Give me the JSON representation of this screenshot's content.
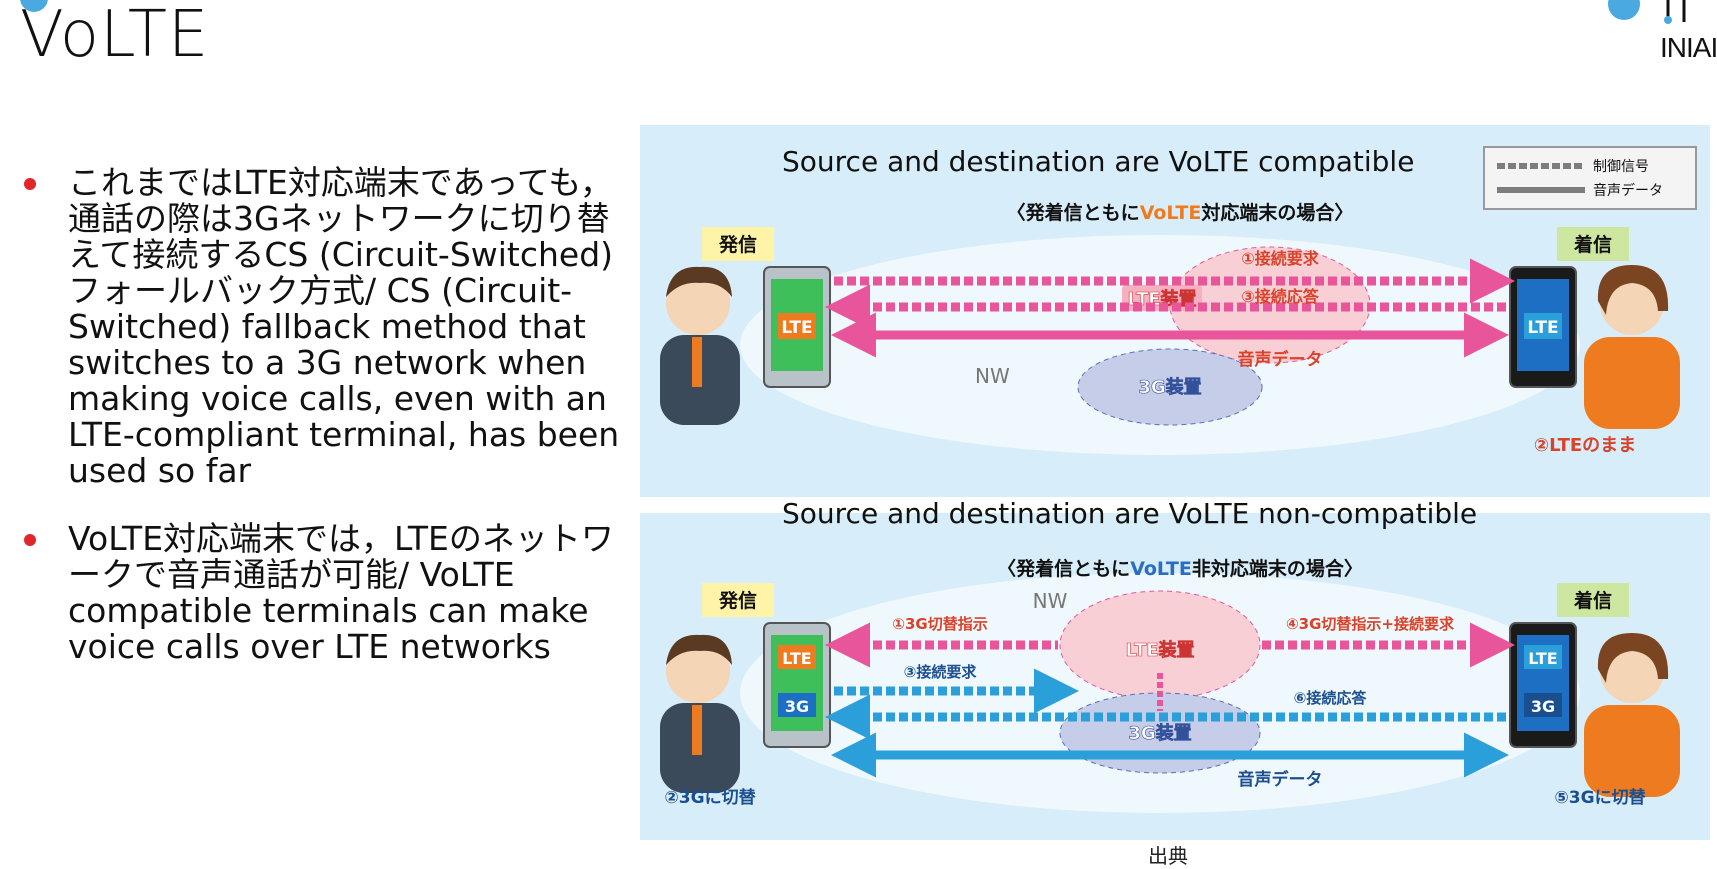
{
  "slide": {
    "title": "VoLTE",
    "logo_text": "INIAI",
    "citation": "出典"
  },
  "bullets": [
    {
      "text": "これまではLTE対応端末であっても，通話の際は3Gネットワークに切り替えて接続するCS (Circuit-Switched)フォールバック方式/ CS (Circuit-Switched) fallback method that switches to a 3G network when making voice calls, even with an LTE-compliant terminal, has been used so far"
    },
    {
      "text": "VoLTE対応端末では，LTEのネットワークで音声通話が可能/ VoLTE compatible terminals can make voice calls over LTE networks"
    }
  ],
  "figure": {
    "caption_top": "Source and destination are VoLTE compatible",
    "caption_bottom": "Source and destination are VoLTE non-compatible",
    "legend": {
      "signal": "制御信号",
      "voice": "音声データ"
    },
    "top": {
      "heading_pre": "〈発着信ともに",
      "heading_hl": "VoLTE",
      "heading_post": "対応端末の場合〉",
      "caller": "発信",
      "callee": "着信",
      "lte_device": "LTE装置",
      "g3_device": "3G装置",
      "nw": "NW",
      "phone_label": "LTE",
      "arrow1": "①接続要求",
      "arrow3": "③接続応答",
      "voice": "音声データ",
      "stay_lte": "②LTEのまま"
    },
    "bottom": {
      "heading_pre": "〈発着信ともに",
      "heading_hl": "VoLTE",
      "heading_post": "非対応端末の場合〉",
      "caller": "発信",
      "callee": "着信",
      "nw": "NW",
      "lte_device": "LTE装置",
      "g3_device": "3G装置",
      "phone_lte": "LTE",
      "phone_3g": "3G",
      "arrow1": "①3G切替指示",
      "arrow4": "④3G切替指示+接続要求",
      "arrow3": "③接続要求",
      "arrow6": "⑥接続応答",
      "voice": "音声データ",
      "switch_caller": "②3Gに切替",
      "switch_callee": "⑤3Gに切替"
    }
  },
  "colors": {
    "accent_dot": "#4aa9e0",
    "bullet_dot": "#e0262a",
    "panel_bg": "#d7edf9",
    "pink": "#e8559a",
    "blue": "#2b9fda",
    "orange_hl": "#ee7b1f",
    "blue_hl": "#2a6dc2"
  }
}
